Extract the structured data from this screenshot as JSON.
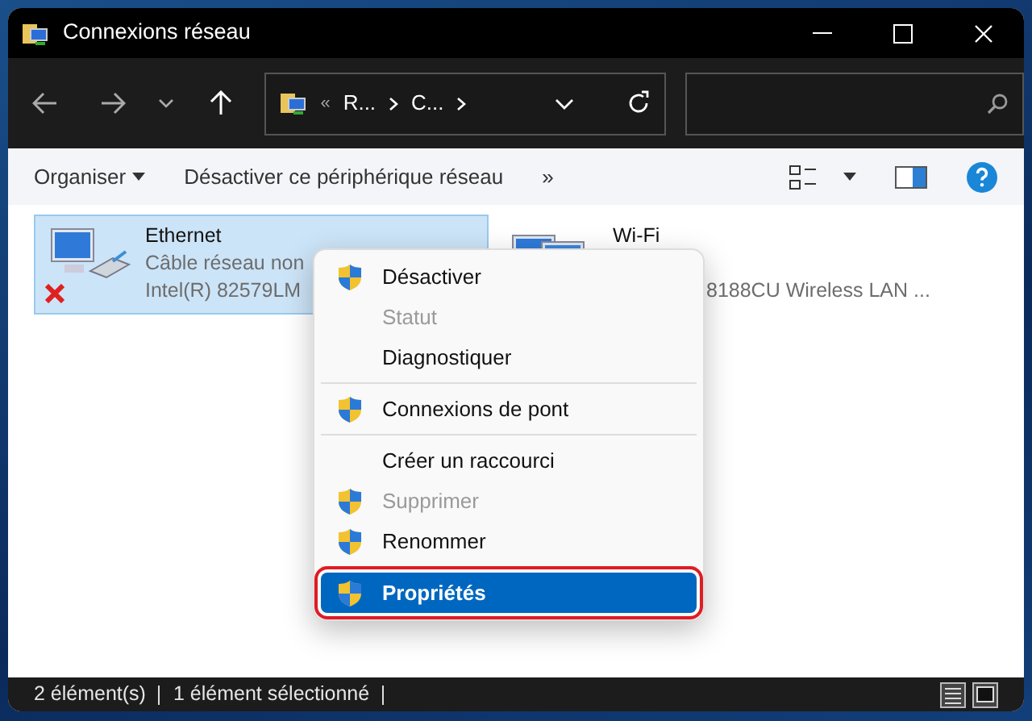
{
  "window": {
    "title": "Connexions réseau"
  },
  "address_bar": {
    "separator": "«",
    "crumbs": [
      "R...",
      "C..."
    ]
  },
  "command_bar": {
    "organize": "Organiser",
    "action": "Désactiver ce périphérique réseau",
    "more": "»"
  },
  "connections": [
    {
      "name": "Ethernet",
      "lines": [
        "Câble réseau non",
        "Intel(R) 82579LM"
      ],
      "selected": true,
      "disconnected": true,
      "kind": "wired"
    },
    {
      "name": "Wi-Fi",
      "lines": [
        "8188CU Wireless LAN ..."
      ],
      "selected": false,
      "kind": "wireless"
    }
  ],
  "context_menu": {
    "groups": [
      [
        {
          "label": "Désactiver",
          "shield": true,
          "disabled": false,
          "selected": false
        },
        {
          "label": "Statut",
          "shield": false,
          "disabled": true,
          "selected": false
        },
        {
          "label": "Diagnostiquer",
          "shield": false,
          "disabled": false,
          "selected": false
        }
      ],
      [
        {
          "label": "Connexions de pont",
          "shield": true,
          "disabled": false,
          "selected": false
        }
      ],
      [
        {
          "label": "Créer un raccourci",
          "shield": false,
          "disabled": false,
          "selected": false
        },
        {
          "label": "Supprimer",
          "shield": true,
          "disabled": true,
          "selected": false
        },
        {
          "label": "Renommer",
          "shield": true,
          "disabled": false,
          "selected": false
        }
      ],
      [
        {
          "label": "Propriétés",
          "shield": true,
          "disabled": false,
          "selected": true
        }
      ]
    ]
  },
  "status_bar": {
    "count": "2 élément(s)",
    "selection": "1 élément sélectionné"
  }
}
